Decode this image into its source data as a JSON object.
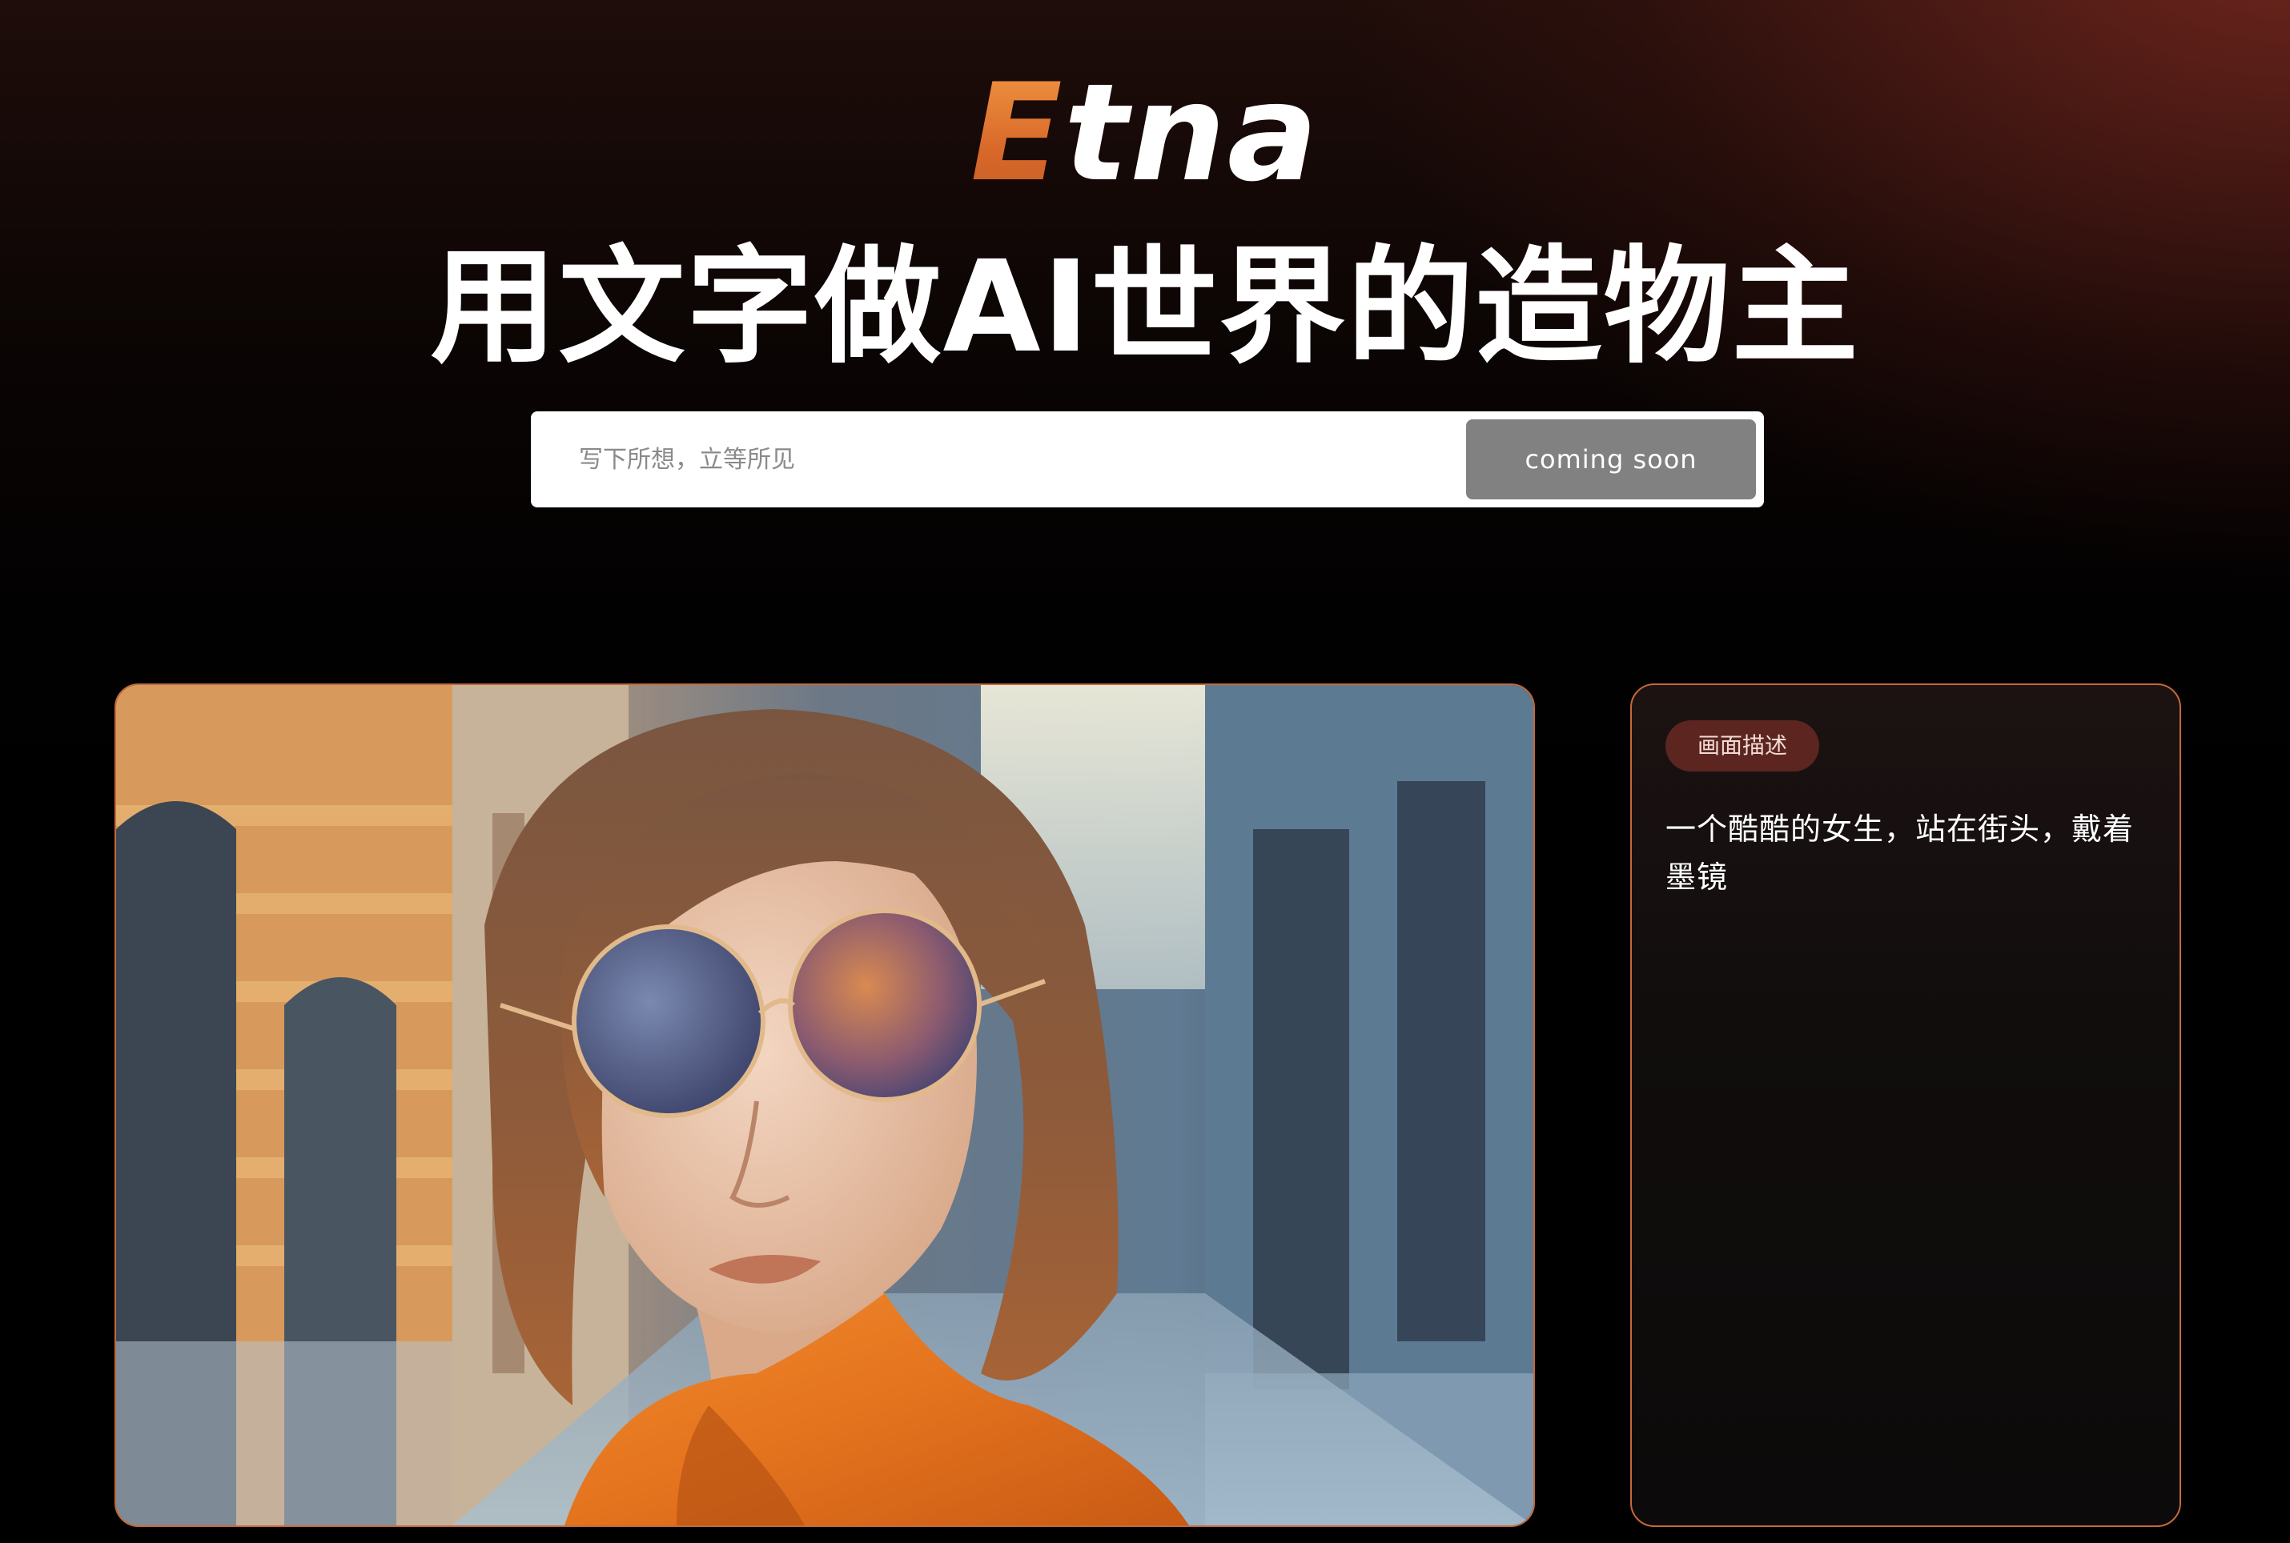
{
  "brand": {
    "logo_first": "E",
    "logo_rest": "tna",
    "logo_colors": {
      "accent": "#e07a30",
      "text": "#ffffff"
    }
  },
  "hero": {
    "headline": "用文字做AI世界的造物主"
  },
  "search": {
    "placeholder": "写下所想，立等所见",
    "value": "",
    "button_label": "coming soon"
  },
  "showcase": {
    "image_icon": "portrait-photo-image",
    "tag_label": "画面描述",
    "description": "一个酷酷的女生，站在街头，戴着墨镜"
  },
  "colors": {
    "accent_border": "#c4693a",
    "tag_background": "#5c2520",
    "button_background": "#818181"
  }
}
